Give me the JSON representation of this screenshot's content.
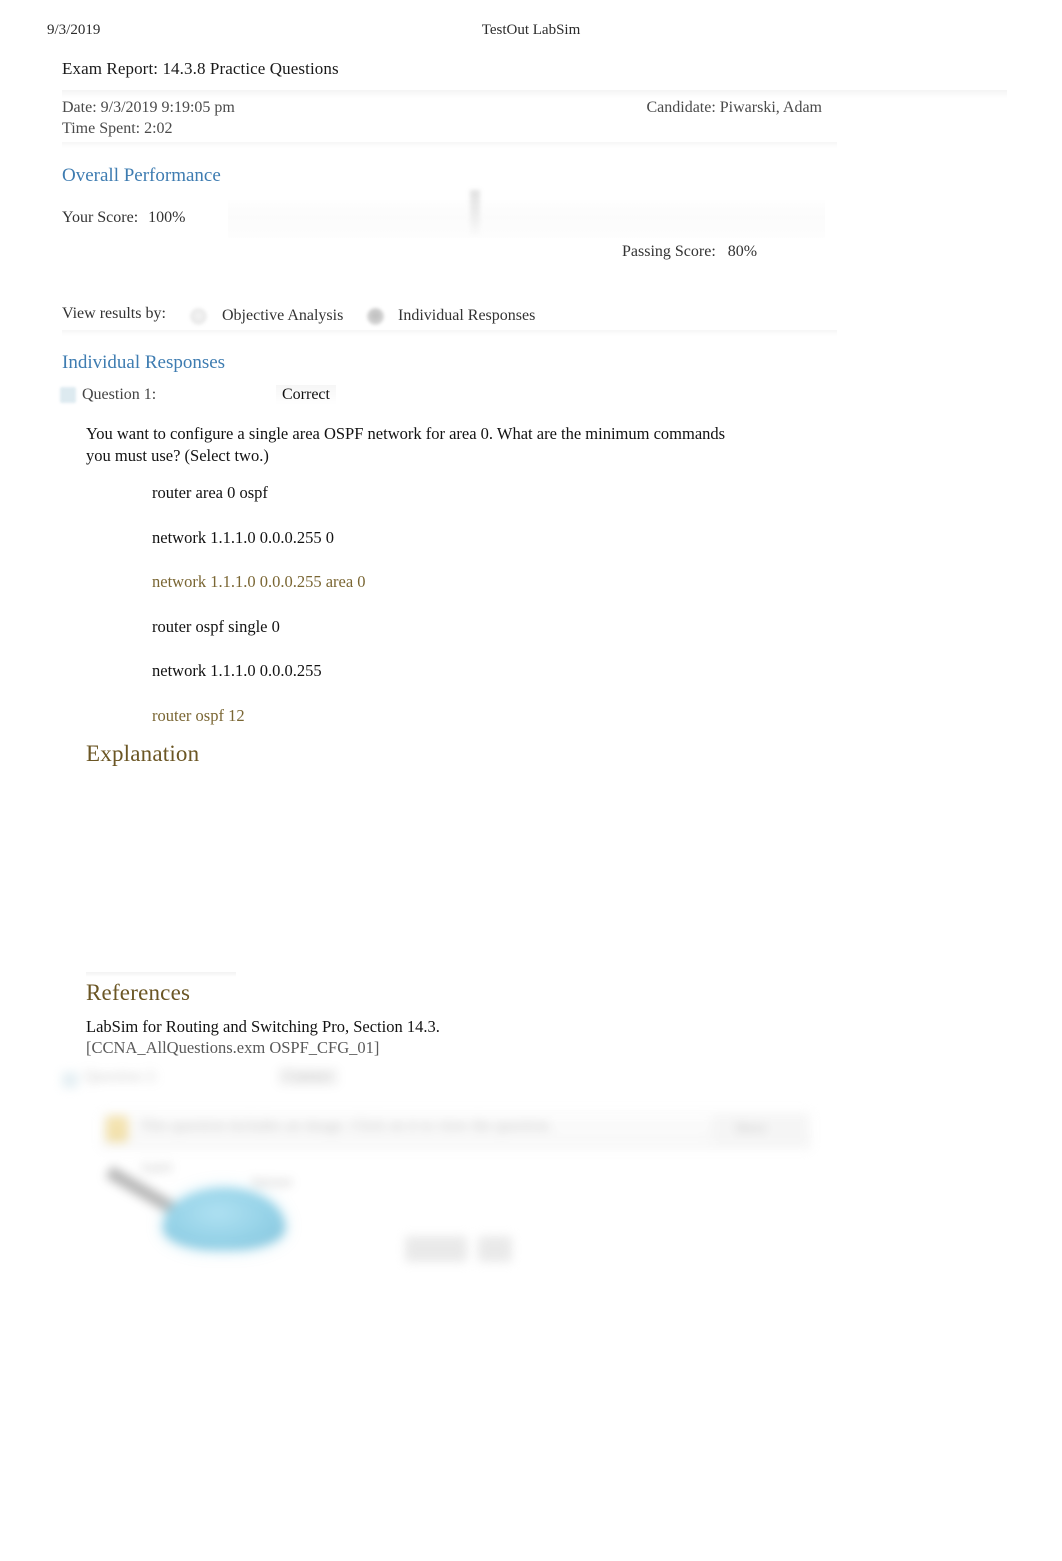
{
  "print_header": {
    "date": "9/3/2019",
    "app_title": "TestOut LabSim"
  },
  "report": {
    "title": "Exam Report: 14.3.8 Practice Questions",
    "date_label": "Date: 9/3/2019 9:19:05 pm",
    "time_spent_label": "Time Spent: 2:02",
    "candidate_label": "Candidate: Piwarski, Adam"
  },
  "overall_performance": {
    "heading": "Overall Performance",
    "your_score_label": "Your Score:",
    "your_score_value": "100%",
    "passing_score_label": "Passing Score:",
    "passing_score_value": "80%"
  },
  "view_results": {
    "label": "View results by:",
    "options": [
      {
        "label": "Objective Analysis",
        "selected": false
      },
      {
        "label": "Individual Responses",
        "selected": true
      }
    ]
  },
  "individual_responses": {
    "heading": "Individual Responses",
    "question": {
      "label": "Question 1:",
      "status": "Correct",
      "text": "You want to configure a single area OSPF network for area 0. What are the minimum commands you must use? (Select two.)",
      "options": [
        {
          "text": "router area 0 ospf",
          "correct": false
        },
        {
          "text": "network 1.1.1.0 0.0.0.255 0",
          "correct": false
        },
        {
          "text": "network 1.1.1.0 0.0.0.255 area 0",
          "correct": true
        },
        {
          "text": "router ospf single 0",
          "correct": false
        },
        {
          "text": "network 1.1.1.0 0.0.0.255",
          "correct": false
        },
        {
          "text": "router ospf 12",
          "correct": true
        }
      ]
    },
    "explanation": {
      "heading": "Explanation",
      "body": ""
    },
    "references": {
      "heading": "References",
      "lines": [
        "LabSim for Routing and Switching Pro, Section 14.3.",
        "[CCNA_AllQuestions.exm OSPF_CFG_01]"
      ]
    }
  },
  "faded_next": {
    "question_label": "Question 2:",
    "status": "Correct",
    "notice_text": "This question includes an image. Click on it to view the question.",
    "button_label": "Show",
    "diagram_label_a": "Fa0/0",
    "diagram_label_b": "Internet"
  },
  "colors": {
    "section_heading": "#3e7cb1",
    "block_heading": "#6b5624",
    "correct_answer": "#7a6633",
    "body_text": "#121212",
    "meta_text": "#4a4a4a"
  }
}
